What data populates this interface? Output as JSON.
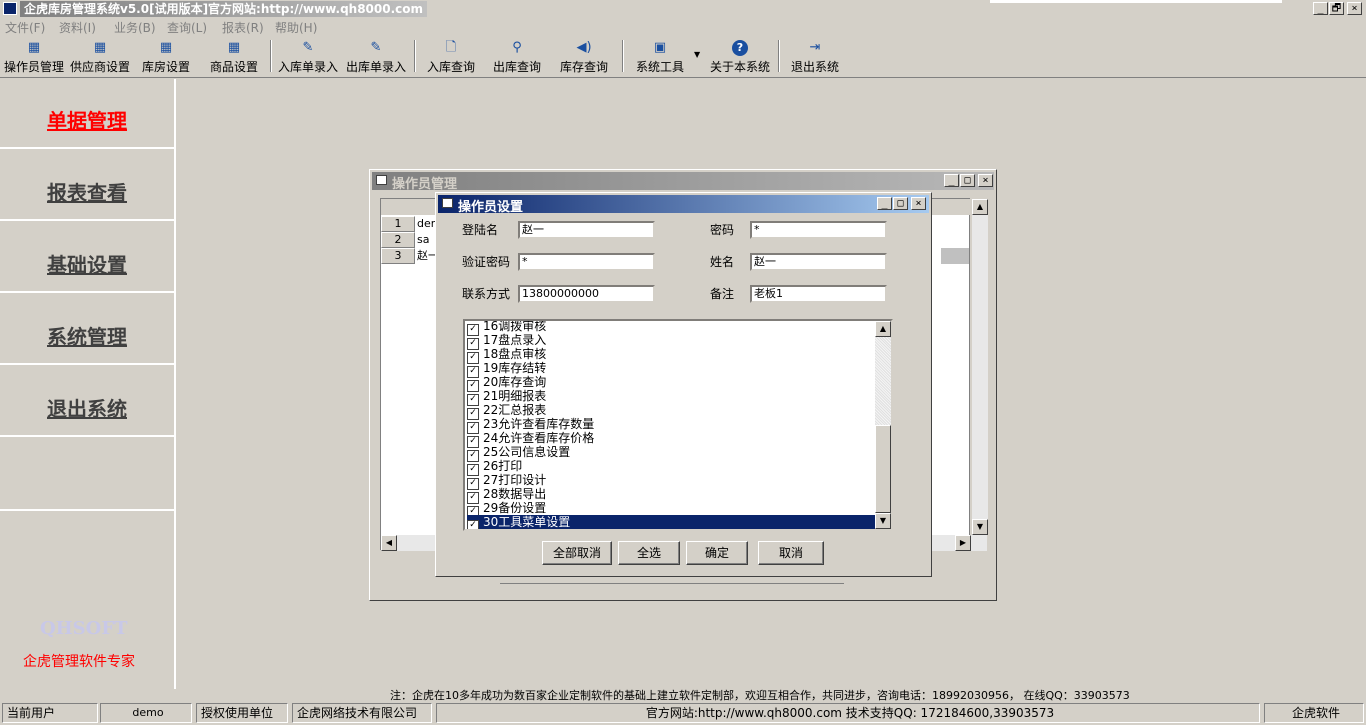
{
  "app": {
    "title": "企虎库房管理系统v5.0[试用版本]官方网站:http://www.qh8000.com",
    "window_controls": [
      "_",
      "🗗",
      "×"
    ]
  },
  "menu": [
    "文件(F)",
    "资料(I)",
    "业务(B)",
    "查询(L)",
    "报表(R)",
    "帮助(H)"
  ],
  "toolbar": [
    {
      "label": "操作员管理",
      "icon": "spreadsheet-icon"
    },
    {
      "label": "供应商设置",
      "icon": "spreadsheet-icon"
    },
    {
      "label": "库房设置",
      "icon": "spreadsheet-icon"
    },
    {
      "label": "商品设置",
      "icon": "spreadsheet-icon"
    },
    {
      "label": "入库单录入",
      "icon": "pen-icon"
    },
    {
      "label": "出库单录入",
      "icon": "pen-icon"
    },
    {
      "label": "入库查询",
      "icon": "document-search-icon"
    },
    {
      "label": "出库查询",
      "icon": "magnifier-icon"
    },
    {
      "label": "库存查询",
      "icon": "speaker-icon"
    },
    {
      "label": "系统工具",
      "icon": "chart-window-icon"
    },
    {
      "label": "关于本系统",
      "icon": "help-icon"
    },
    {
      "label": "退出系统",
      "icon": "exit-door-icon"
    }
  ],
  "nav": [
    "单据管理",
    "报表查看",
    "基础设置",
    "系统管理",
    "退出系统"
  ],
  "brand": {
    "logo": "QHSOFT",
    "slogan": "企虎管理软件专家"
  },
  "operator_window": {
    "title": "操作员管理",
    "rows": [
      {
        "no": "1",
        "name": "dem"
      },
      {
        "no": "2",
        "name": "sa"
      },
      {
        "no": "3",
        "name": "赵一"
      }
    ]
  },
  "dialog": {
    "title": "操作员设置",
    "fields": {
      "login_label": "登陆名",
      "login_value": "赵一",
      "password_label": "密码",
      "password_value": "*",
      "verify_label": "验证密码",
      "verify_value": "*",
      "name_label": "姓名",
      "name_value": "赵一",
      "contact_label": "联系方式",
      "contact_value": "13800000000",
      "note_label": "备注",
      "note_value": "老板1"
    },
    "permissions": [
      "16调拨审核",
      "17盘点录入",
      "18盘点审核",
      "19库存结转",
      "20库存查询",
      "21明细报表",
      "22汇总报表",
      "23允许查看库存数量",
      "24允许查看库存价格",
      "25公司信息设置",
      "26打印",
      "27打印设计",
      "28数据导出",
      "29备份设置",
      "30工具菜单设置"
    ],
    "buttons": {
      "clear_all": "全部取消",
      "select_all": "全选",
      "ok": "确定",
      "cancel": "取消"
    }
  },
  "notice": "注：企虎在10多年成功为数百家企业定制软件的基础上建立软件定制部，欢迎互相合作，共同进步，咨询电话：18992030956， 在线QQ：33903573",
  "status": {
    "current_user_label": "当前用户",
    "current_user": "demo",
    "licensee_label": "授权使用单位",
    "licensee": "企虎网络技术有限公司",
    "site": "官方网站:http://www.qh8000.com 技术支持QQ: 172184600,33903573",
    "brand": "企虎软件"
  }
}
